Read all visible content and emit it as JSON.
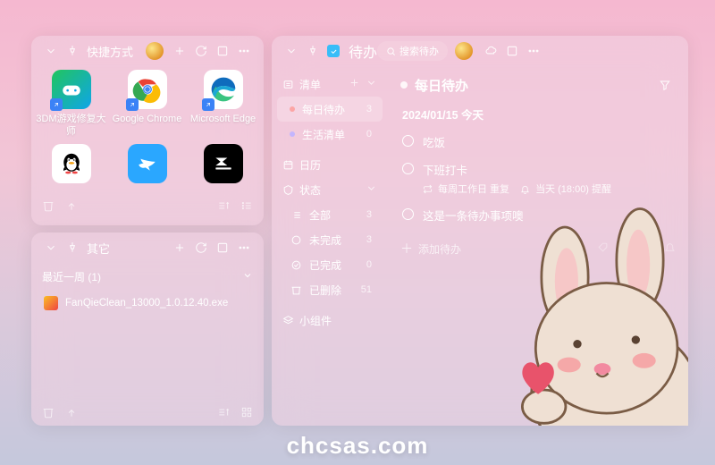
{
  "shortcuts": {
    "title": "快捷方式",
    "apps": [
      {
        "label": "3DM游戏修复大师"
      },
      {
        "label": "Google Chrome"
      },
      {
        "label": "Microsoft Edge"
      },
      {
        "label": ""
      },
      {
        "label": ""
      },
      {
        "label": ""
      }
    ]
  },
  "others": {
    "title": "其它",
    "section": "最近一周 (1)",
    "file": "FanQieClean_13000_1.0.12.40.exe"
  },
  "todo": {
    "title": "待办",
    "search_placeholder": "搜索待办",
    "sidebar": {
      "list_header": "清单",
      "items": [
        {
          "label": "每日待办",
          "count": "3"
        },
        {
          "label": "生活清单",
          "count": "0"
        }
      ],
      "calendar": "日历",
      "status_header": "状态",
      "status": [
        {
          "label": "全部",
          "count": "3"
        },
        {
          "label": "未完成",
          "count": "3"
        },
        {
          "label": "已完成",
          "count": "0"
        },
        {
          "label": "已删除",
          "count": "51"
        }
      ],
      "widgets": "小组件"
    },
    "main": {
      "title": "每日待办",
      "date": "2024/01/15 今天",
      "tasks": [
        {
          "title": "吃饭"
        },
        {
          "title": "下班打卡",
          "repeat": "每周工作日 重复",
          "remind": "当天 (18:00) 提醒"
        },
        {
          "title": "这是一条待办事项噢"
        }
      ],
      "add_label": "添加待办"
    }
  },
  "watermark": "chcsas.com"
}
